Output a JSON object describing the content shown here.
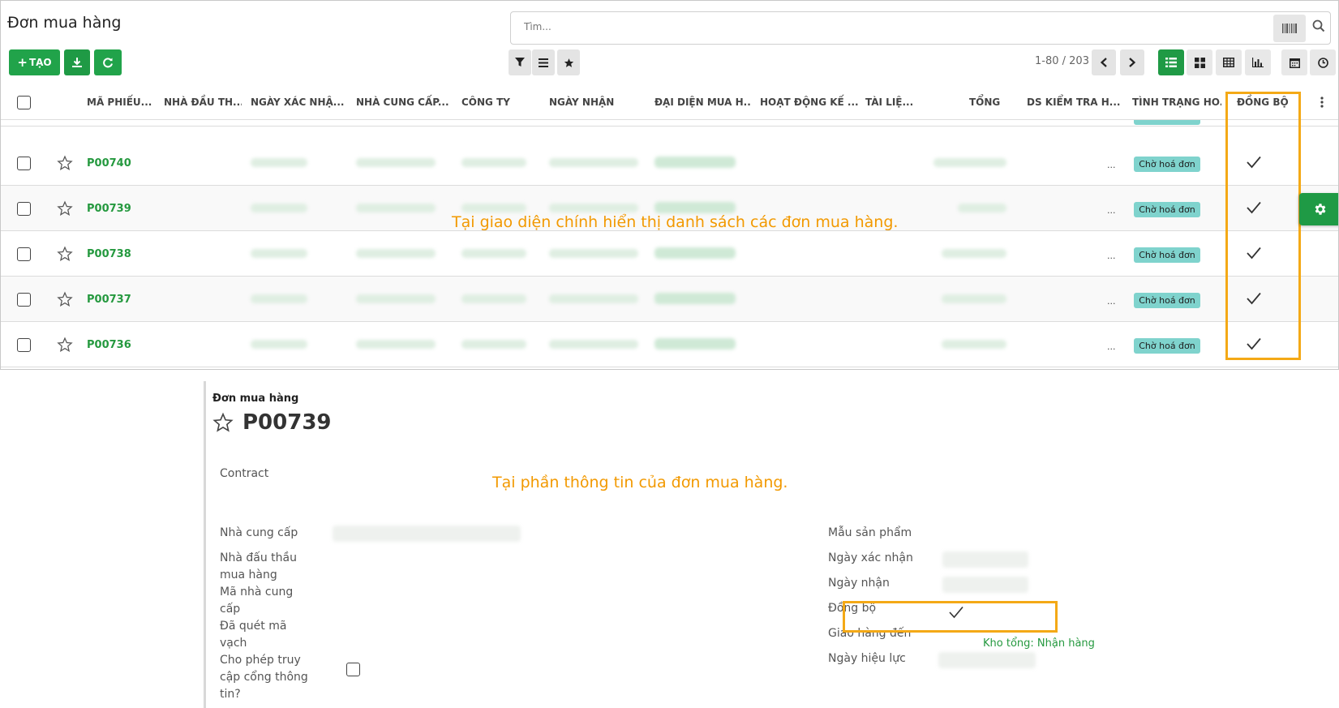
{
  "list": {
    "title": "Đơn mua hàng",
    "search_placeholder": "Tìm...",
    "create_label": "TẠO",
    "pager": "1-80 / 203",
    "columns": [
      "MÃ PHIẾU...",
      "NHÀ ĐẦU TH...",
      "NGÀY XÁC NHẬ...",
      "NHÀ CUNG CẤP...",
      "CÔNG TY",
      "NGÀY NHẬN",
      "ĐẠI DIỆN MUA H...",
      "HOẠT ĐỘNG KẾ ...",
      "TÀI LIỆ...",
      "TỔNG",
      "DS KIỂM TRA H...",
      "TÌNH TRẠNG HO...",
      "ĐỒNG BỘ"
    ],
    "rows": [
      {
        "code": "P00740",
        "ds_check": "...",
        "status": "Chờ hoá đơn",
        "synced": true
      },
      {
        "code": "P00739",
        "ds_check": "...",
        "status": "Chờ hoá đơn",
        "synced": true
      },
      {
        "code": "P00738",
        "ds_check": "...",
        "status": "Chờ hoá đơn",
        "synced": true
      },
      {
        "code": "P00737",
        "ds_check": "...",
        "status": "Chờ hoá đơn",
        "synced": true
      },
      {
        "code": "P00736",
        "ds_check": "...",
        "status": "Chờ hoá đơn",
        "synced": true
      }
    ],
    "caption": "Tại giao diện chính hiển thị danh sách các đơn mua hàng."
  },
  "form": {
    "breadcrumb": "Đơn mua hàng",
    "title": "P00739",
    "contract_label": "Contract",
    "caption": "Tại phần thông tin của  đơn mua hàng.",
    "left_labels": {
      "supplier": "Nhà cung cấp",
      "bidder_line1": "Nhà đấu thầu",
      "bidder_line2": "mua hàng",
      "supplier_code_line1": "Mã nhà cung",
      "supplier_code_line2": "cấp",
      "scanned_line1": "Đã quét mã",
      "scanned_line2": "vạch",
      "portal_line1": "Cho phép truy",
      "portal_line2": "cập cổng thông",
      "portal_line3": "tin?"
    },
    "right_labels": {
      "product_template": "Mẫu sản phẩm",
      "confirm_date": "Ngày xác nhận",
      "receive_date": "Ngày nhận",
      "sync": "Đồng bộ",
      "deliver_to": "Giao hàng đến",
      "effective_date": "Ngày hiệu lực"
    },
    "deliver_to_value": "Kho tổng: Nhận hàng"
  },
  "colors": {
    "accent": "#1f9a45",
    "highlight": "#f4a916",
    "caption": "#f29900",
    "badge": "#7fd3cd"
  }
}
